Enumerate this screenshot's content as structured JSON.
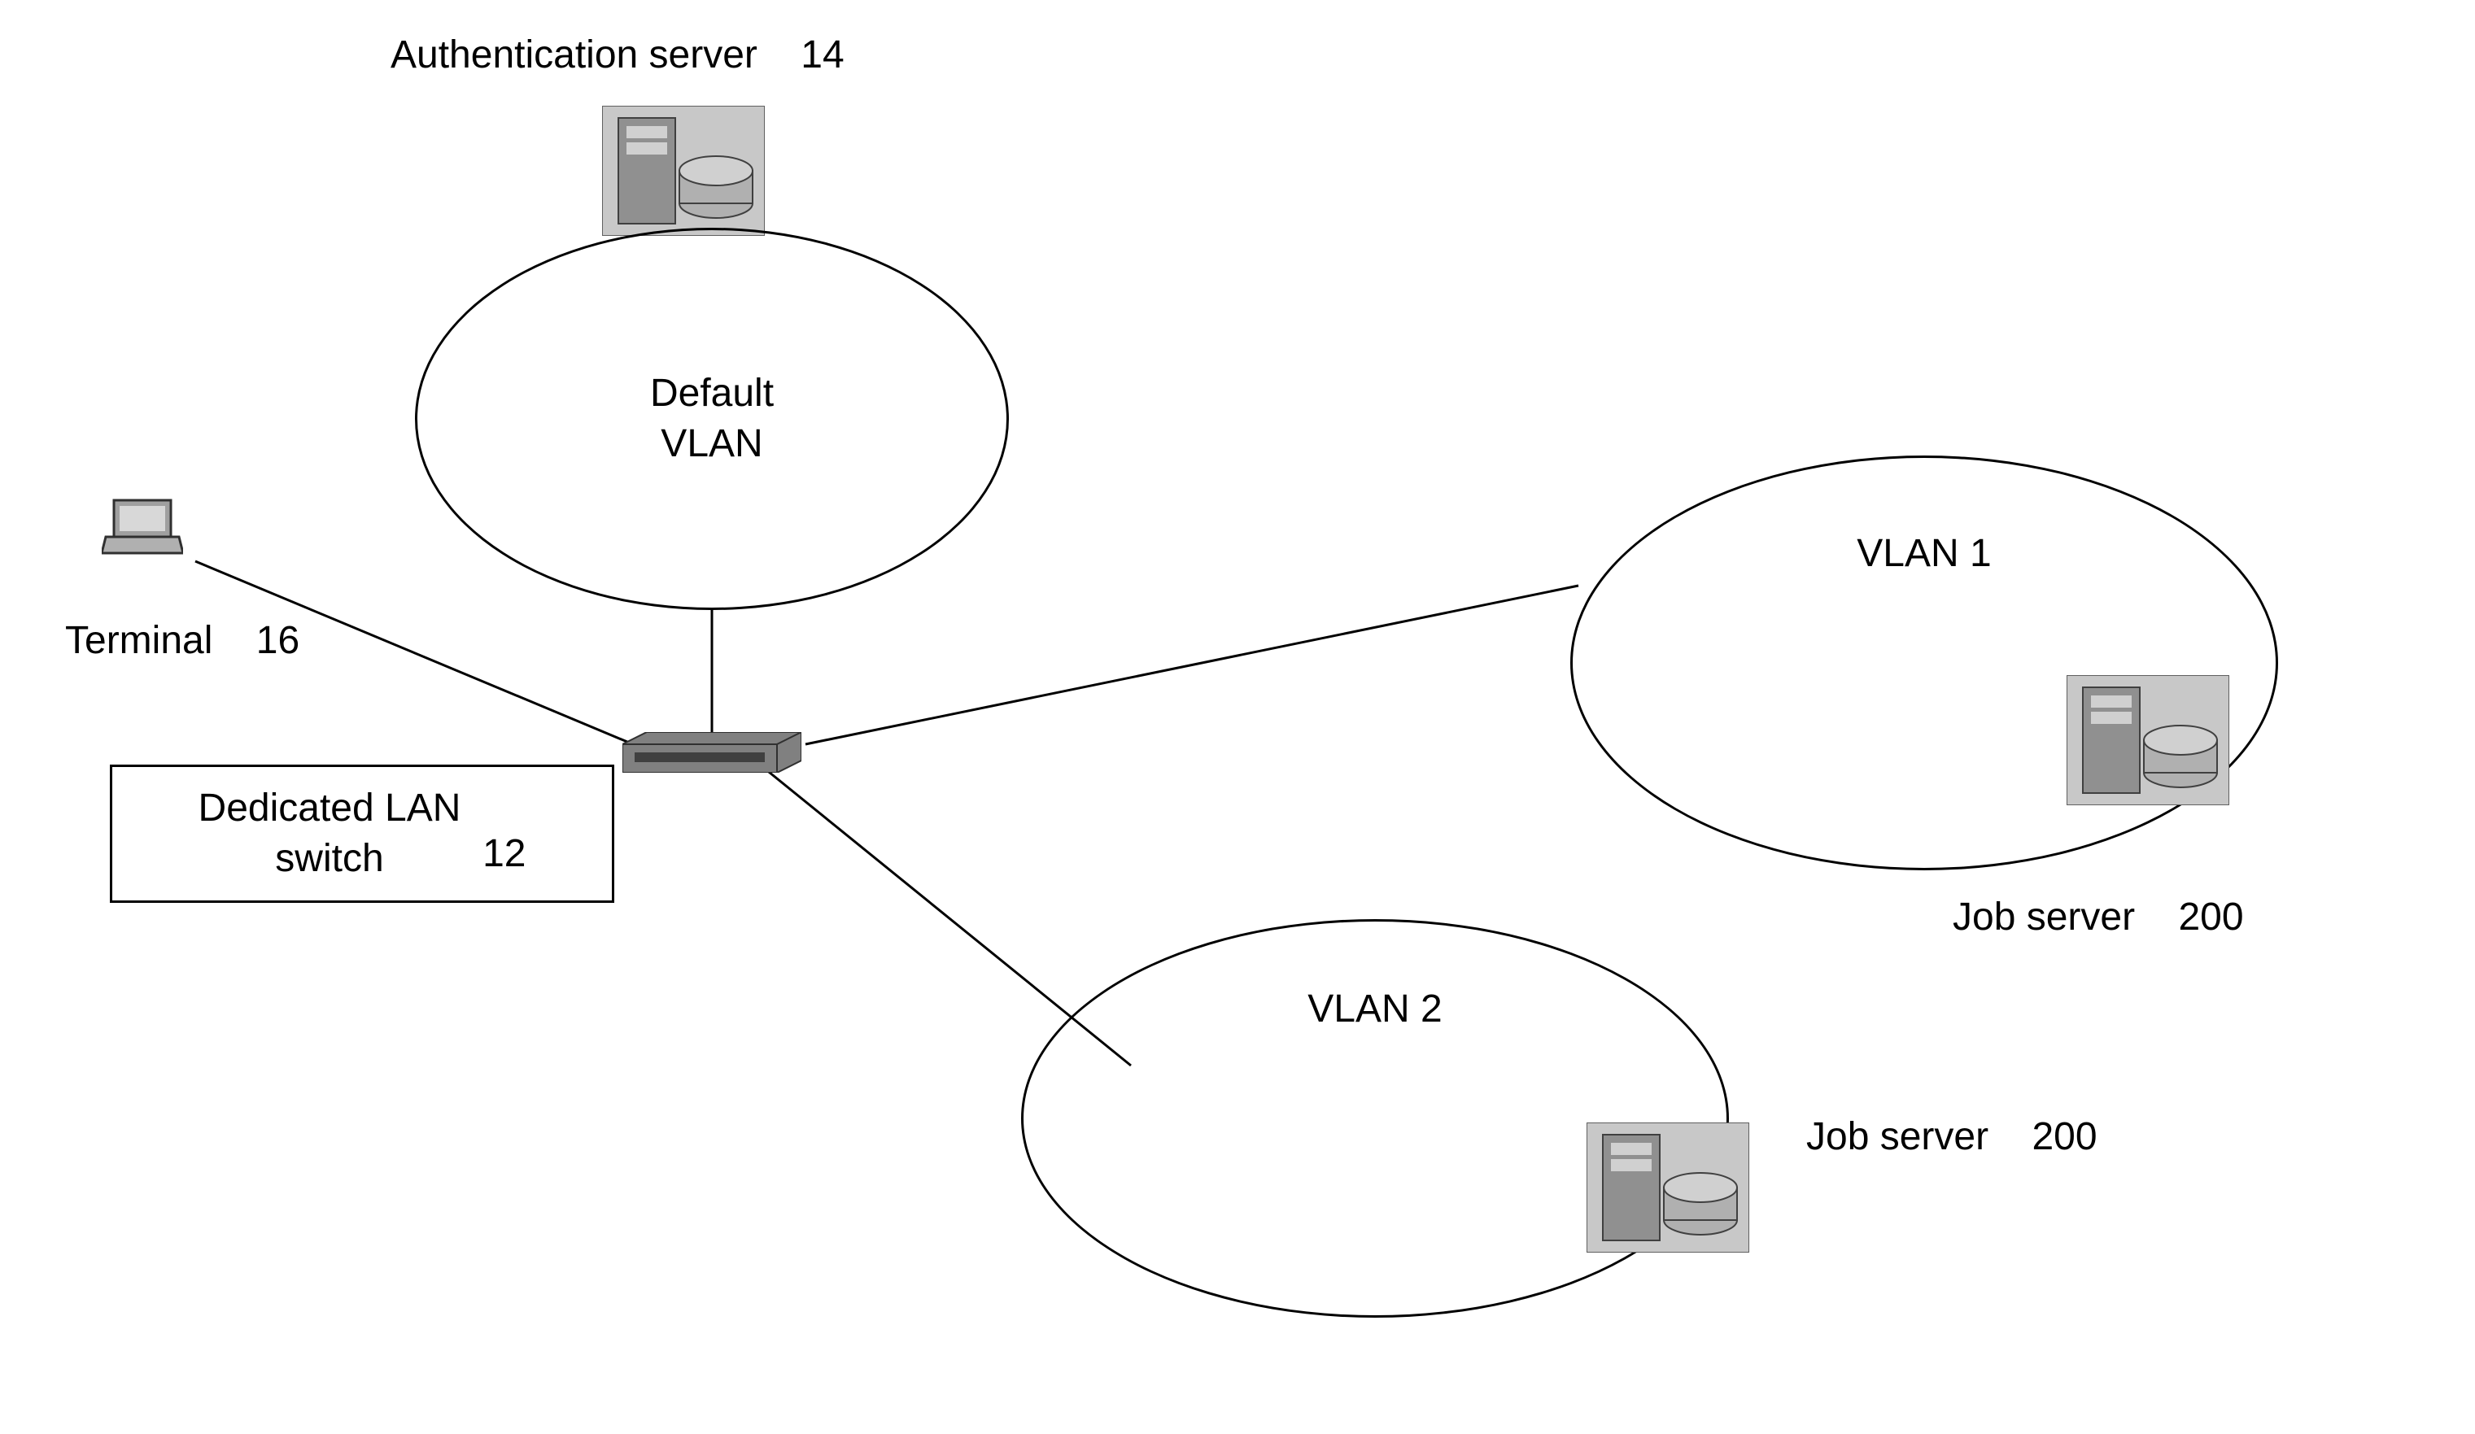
{
  "authServer": {
    "label": "Authentication server",
    "number": "14"
  },
  "defaultVlan": {
    "label": "Default\nVLAN"
  },
  "terminal": {
    "label": "Terminal",
    "number": "16"
  },
  "lanSwitch": {
    "label": "Dedicated LAN\nswitch",
    "number": "12"
  },
  "vlan1": {
    "label": "VLAN 1"
  },
  "vlan2": {
    "label": "VLAN 2"
  },
  "jobServer1": {
    "label": "Job server",
    "number": "200"
  },
  "jobServer2": {
    "label": "Job server",
    "number": "200"
  }
}
